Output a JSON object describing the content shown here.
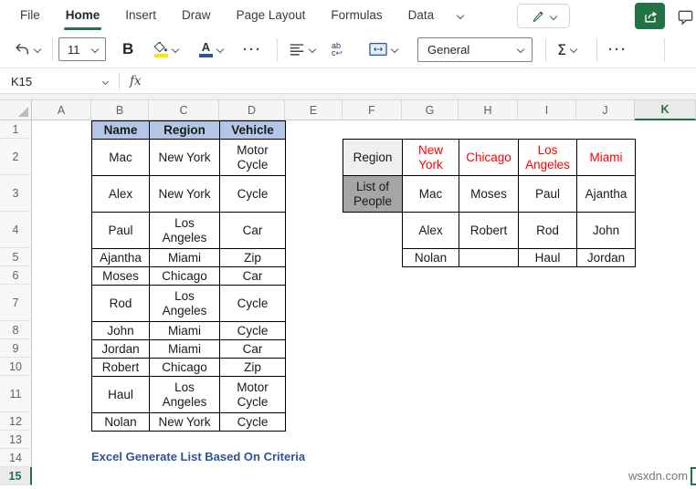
{
  "ribbon": {
    "tabs": [
      "File",
      "Home",
      "Insert",
      "Draw",
      "Page Layout",
      "Formulas",
      "Data"
    ],
    "active_tab": "Home"
  },
  "toolbar": {
    "font_size": "11",
    "bold_label": "B",
    "ellipsis_1": "···",
    "ellipsis_2": "···",
    "number_format": "General",
    "sigma_label": "Σ",
    "wrap_line1": "ab",
    "wrap_line2": "c",
    "wrap_arrow": "↩"
  },
  "formula_bar": {
    "cell_reference": "K15",
    "fx_label": "fx",
    "formula": ""
  },
  "sheet": {
    "columns": [
      "A",
      "B",
      "C",
      "D",
      "E",
      "F",
      "G",
      "H",
      "I",
      "J",
      "K"
    ],
    "selected_column": "K",
    "rows": [
      "1",
      "2",
      "3",
      "4",
      "5",
      "6",
      "7",
      "8",
      "9",
      "10",
      "11",
      "12",
      "13",
      "14",
      "15"
    ],
    "selected_row": "15"
  },
  "data_table": {
    "headers": [
      "Name",
      "Region",
      "Vehicle"
    ],
    "rows": [
      [
        "Mac",
        "New York",
        "Motor Cycle"
      ],
      [
        "Alex",
        "New York",
        "Cycle"
      ],
      [
        "Paul",
        "Los Angeles",
        "Car"
      ],
      [
        "Ajantha",
        "Miami",
        "Zip"
      ],
      [
        "Moses",
        "Chicago",
        "Car"
      ],
      [
        "Rod",
        "Los Angeles",
        "Cycle"
      ],
      [
        "John",
        "Miami",
        "Cycle"
      ],
      [
        "Jordan",
        "Miami",
        "Car"
      ],
      [
        "Robert",
        "Chicago",
        "Zip"
      ],
      [
        "Haul",
        "Los Angeles",
        "Motor Cycle"
      ],
      [
        "Nolan",
        "New York",
        "Cycle"
      ]
    ]
  },
  "pivot_table": {
    "corner_label": "Region",
    "region_headers": [
      "New York",
      "Chicago",
      "Los Angeles",
      "Miami"
    ],
    "list_label": "List of People",
    "people_rows": [
      [
        "Mac",
        "Moses",
        "Paul",
        "Ajantha"
      ],
      [
        "Alex",
        "Robert",
        "Rod",
        "John"
      ],
      [
        "Nolan",
        "",
        "Haul",
        "Jordan"
      ]
    ]
  },
  "caption": "Excel Generate List Based On Criteria",
  "watermark": "wsxdn.com",
  "colors": {
    "excel_green": "#217346",
    "table_header_blue": "#B4C6E7",
    "region_text_red": "#FF0000",
    "corner_gray": "#EFEFEF",
    "list_label_gray": "#A6A6A6",
    "caption_blue": "#2F5496"
  }
}
